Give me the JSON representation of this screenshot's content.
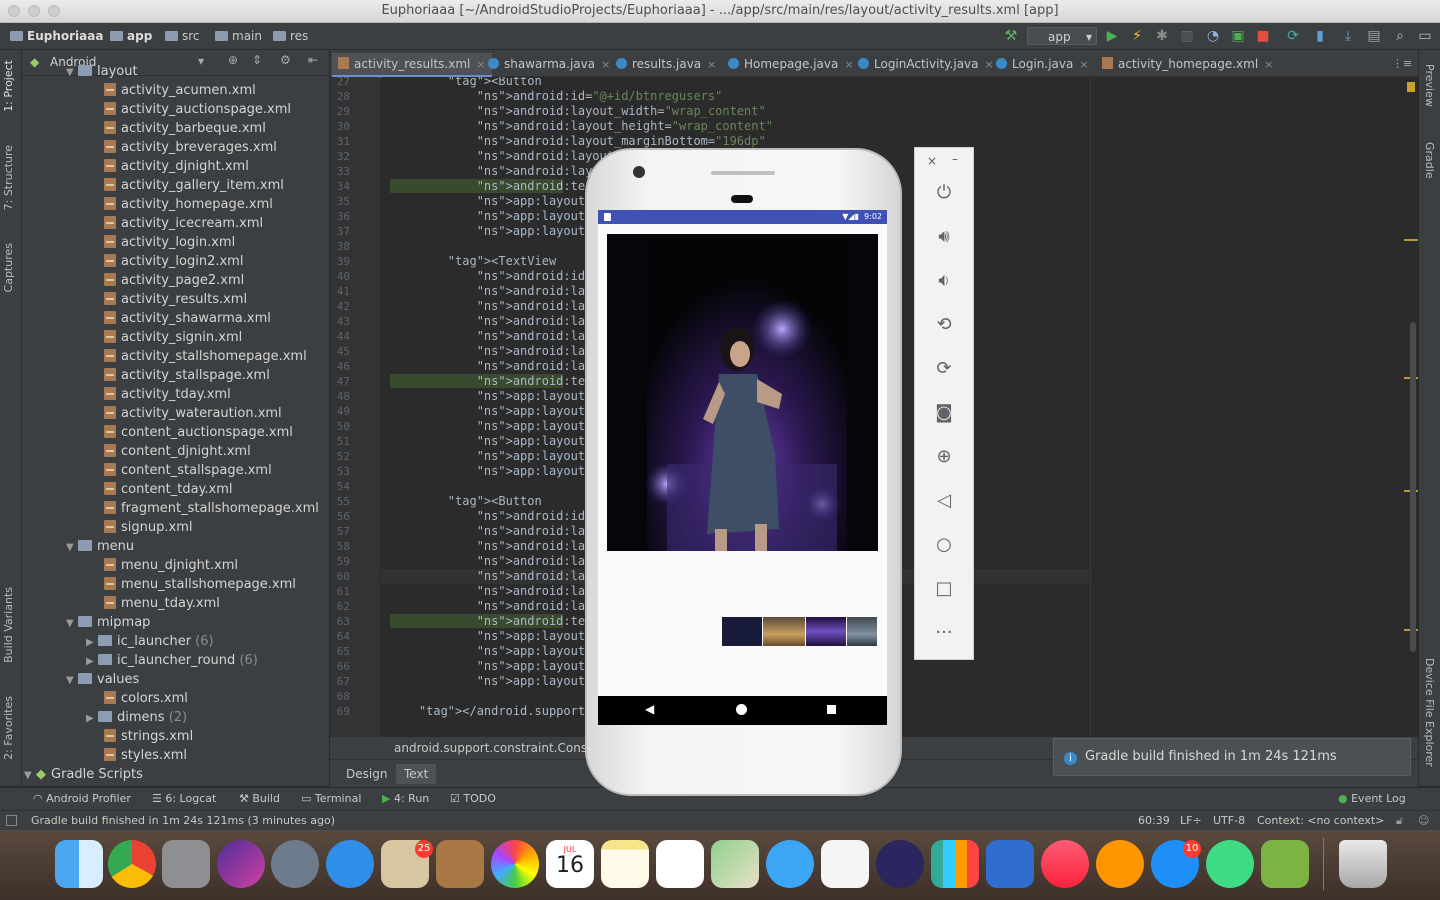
{
  "window": {
    "title": "Euphoriaaa [~/AndroidStudioProjects/Euphoriaaa] - .../app/src/main/res/layout/activity_results.xml [app]"
  },
  "navbar": {
    "crumbs": [
      "Euphoriaaa",
      "app",
      "src",
      "main",
      "res"
    ],
    "run_config": "app"
  },
  "left_tool_tabs": [
    "1: Project",
    "7: Structure",
    "Captures",
    "Build Variants",
    "2: Favorites"
  ],
  "right_tool_tabs": [
    "Preview",
    "Gradle",
    "Device File Explorer"
  ],
  "project": {
    "view_mode": "Android",
    "partial_top": "layout",
    "layout_files": [
      "activity_acumen.xml",
      "activity_auctionspage.xml",
      "activity_barbeque.xml",
      "activity_breverages.xml",
      "activity_djnight.xml",
      "activity_gallery_item.xml",
      "activity_homepage.xml",
      "activity_icecream.xml",
      "activity_login.xml",
      "activity_login2.xml",
      "activity_page2.xml",
      "activity_results.xml",
      "activity_shawarma.xml",
      "activity_signin.xml",
      "activity_stallshomepage.xml",
      "activity_stallspage.xml",
      "activity_tday.xml",
      "activity_wateraution.xml",
      "content_auctionspage.xml",
      "content_djnight.xml",
      "content_stallspage.xml",
      "content_tday.xml",
      "fragment_stallshomepage.xml",
      "signup.xml"
    ],
    "menu_folder": "menu",
    "menu_files": [
      "menu_djnight.xml",
      "menu_stallshomepage.xml",
      "menu_tday.xml"
    ],
    "mipmap_folder": "mipmap",
    "mipmap_items": [
      {
        "name": "ic_launcher",
        "count": "(6)"
      },
      {
        "name": "ic_launcher_round",
        "count": "(6)"
      }
    ],
    "values_folder": "values",
    "values_items": [
      {
        "name": "colors.xml",
        "count": ""
      },
      {
        "name": "dimens",
        "count": "(2)"
      },
      {
        "name": "strings.xml",
        "count": ""
      },
      {
        "name": "styles.xml",
        "count": ""
      }
    ],
    "gradle_scripts": "Gradle Scripts"
  },
  "editor_tabs": [
    {
      "label": "activity_results.xml",
      "type": "xml",
      "active": true
    },
    {
      "label": "shawarma.java",
      "type": "java",
      "active": false
    },
    {
      "label": "results.java",
      "type": "java",
      "active": false
    },
    {
      "label": "Homepage.java",
      "type": "java",
      "active": false
    },
    {
      "label": "LoginActivity.java",
      "type": "java",
      "active": false
    },
    {
      "label": "Login.java",
      "type": "java",
      "active": false
    },
    {
      "label": "activity_homepage.xml",
      "type": "xml",
      "active": false
    }
  ],
  "code_lines": [
    {
      "n": "27",
      "t": "        <Button"
    },
    {
      "n": "28",
      "t": "            android:id=\"@+id/btnregusers\""
    },
    {
      "n": "29",
      "t": "            android:layout_width=\"wrap_content\""
    },
    {
      "n": "30",
      "t": "            android:layout_height=\"wrap_content\""
    },
    {
      "n": "31",
      "t": "            android:layout_marginBottom=\"196dp\""
    },
    {
      "n": "32",
      "t": "            android:layout_marginEn"
    },
    {
      "n": "33",
      "t": "            android:layout_margin"
    },
    {
      "n": "34",
      "t": "            android:text=\"Get re"
    },
    {
      "n": "35",
      "t": "            app:layout_constrain"
    },
    {
      "n": "36",
      "t": "            app:layout_constrain"
    },
    {
      "n": "37",
      "t": "            app:layout_constrain"
    },
    {
      "n": "38",
      "t": ""
    },
    {
      "n": "39",
      "t": "        <TextView"
    },
    {
      "n": "40",
      "t": "            android:id=\"@+id/res"
    },
    {
      "n": "41",
      "t": "            android:layout_width"
    },
    {
      "n": "42",
      "t": "            android:layout_heigh"
    },
    {
      "n": "43",
      "t": "            android:layout_margi"
    },
    {
      "n": "44",
      "t": "            android:layout_margi"
    },
    {
      "n": "45",
      "t": "            android:layout_margi"
    },
    {
      "n": "46",
      "t": "            android:layout_margi"
    },
    {
      "n": "47",
      "t": "            android:text=\"Pranay"
    },
    {
      "n": "48",
      "t": "            app:layout_constrain"
    },
    {
      "n": "49",
      "t": "            app:layout_constrain"
    },
    {
      "n": "50",
      "t": "            app:layout_constrain"
    },
    {
      "n": "51",
      "t": "            app:layout_constrain"
    },
    {
      "n": "52",
      "t": "            app:layout_constrain"
    },
    {
      "n": "53",
      "t": "            app:layout_constrain"
    },
    {
      "n": "54",
      "t": ""
    },
    {
      "n": "55",
      "t": "        <Button"
    },
    {
      "n": "56",
      "t": "            android:id=\"@+id/bac"
    },
    {
      "n": "57",
      "t": "            android:layout_width"
    },
    {
      "n": "58",
      "t": "            android:layout_heigh"
    },
    {
      "n": "59",
      "t": "            android:layout_margi"
    },
    {
      "n": "60",
      "t": "            android:layout_margi"
    },
    {
      "n": "61",
      "t": "            android:layout_margi"
    },
    {
      "n": "62",
      "t": "            android:layout_margi"
    },
    {
      "n": "63",
      "t": "            android:text=\"Go bac"
    },
    {
      "n": "64",
      "t": "            app:layout_constrain"
    },
    {
      "n": "65",
      "t": "            app:layout_constrain"
    },
    {
      "n": "66",
      "t": "            app:layout_constrain"
    },
    {
      "n": "67",
      "t": "            app:layout_constrain"
    },
    {
      "n": "68",
      "t": ""
    },
    {
      "n": "69",
      "t": "    </android.support.constraint"
    }
  ],
  "editor_breadcrumb": "android.support.constraint.Const",
  "design_tabs": [
    "Design",
    "Text"
  ],
  "bottom_tools": [
    "Android Profiler",
    "6: Logcat",
    "Build",
    "Terminal",
    "4: Run",
    "TODO"
  ],
  "event_log": "Event Log",
  "status": {
    "message": "Gradle build finished in 1m 24s 121ms (3 minutes ago)",
    "position": "60:39",
    "line_sep": "LF÷",
    "encoding": "UTF-8",
    "context": "Context: <no context>"
  },
  "notification": "Gradle build finished in 1m 24s 121ms",
  "emulator": {
    "time": "9:02",
    "controls": [
      "power-icon",
      "volume-up-icon",
      "volume-down-icon",
      "rotate-left-icon",
      "rotate-right-icon",
      "camera-icon",
      "zoom-icon",
      "back-icon",
      "home-icon",
      "overview-icon",
      "more-icon"
    ]
  },
  "dock": {
    "calendar_month": "JUL",
    "calendar_day": "16",
    "mail_badge": "25",
    "appstore_badge": "10"
  }
}
